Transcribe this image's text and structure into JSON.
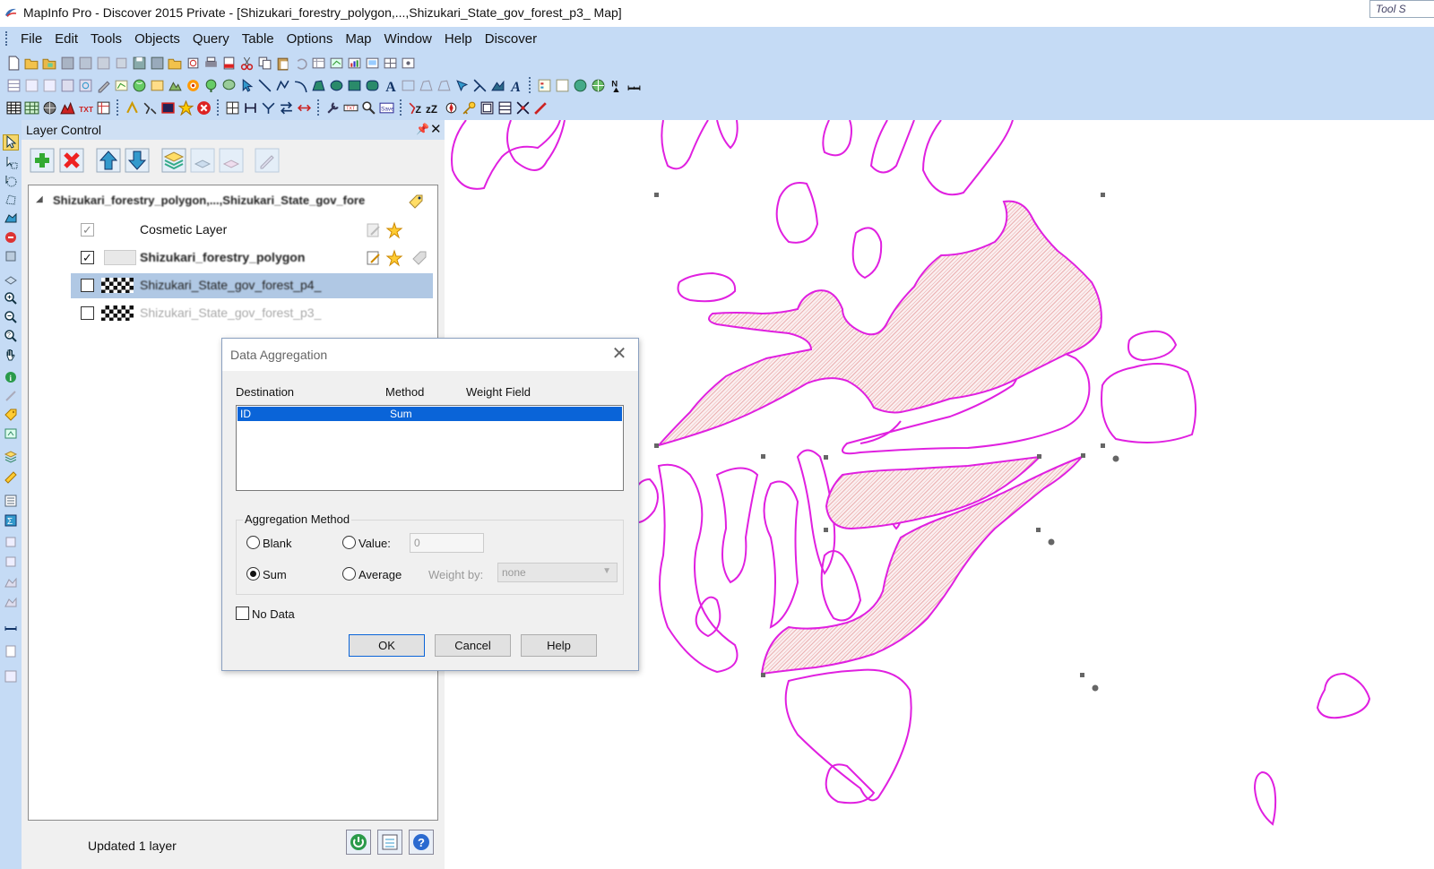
{
  "window": {
    "title": "MapInfo Pro - Discover 2015    Private - [Shizukari_forestry_polygon,...,Shizukari_State_gov_forest_p3_ Map]",
    "tool_search": "Tool S"
  },
  "menu": [
    "File",
    "Edit",
    "Tools",
    "Objects",
    "Query",
    "Table",
    "Options",
    "Map",
    "Window",
    "Help",
    "Discover"
  ],
  "layer_control": {
    "title": "Layer Control",
    "pin_icon": "pin-icon",
    "close_icon": "close-icon",
    "map_name": "Shizukari_forestry_polygon,...,Shizukari_State_gov_fore",
    "layers": [
      {
        "name": "Cosmetic Layer",
        "checked": true
      },
      {
        "name": "Shizukari_forestry_polygon",
        "checked": true
      },
      {
        "name": "Shizukari_State_gov_forest_p4_",
        "checked": false,
        "selected": true
      },
      {
        "name": "Shizukari_State_gov_forest_p3_",
        "checked": false
      }
    ],
    "status": "Updated 1 layer"
  },
  "dialog": {
    "title": "Data Aggregation",
    "columns": {
      "destination": "Destination",
      "method": "Method",
      "weight_field": "Weight Field"
    },
    "rows": [
      {
        "destination": "ID",
        "method": "Sum",
        "weight_field": ""
      }
    ],
    "group_label": "Aggregation Method",
    "options": {
      "blank": "Blank",
      "value": "Value:",
      "value_input": "0",
      "sum": "Sum",
      "average": "Average",
      "weight_by": "Weight by:",
      "weight_by_value": "none"
    },
    "selected_method": "Sum",
    "no_data": "No Data",
    "buttons": {
      "ok": "OK",
      "cancel": "Cancel",
      "help": "Help"
    }
  },
  "colors": {
    "ribbon": "#c5dbf5",
    "polygon_outline": "#e020e0",
    "hatch": "#e08080",
    "selection": "#0a64d8",
    "selected_layer_row": "#b0c8e4"
  }
}
